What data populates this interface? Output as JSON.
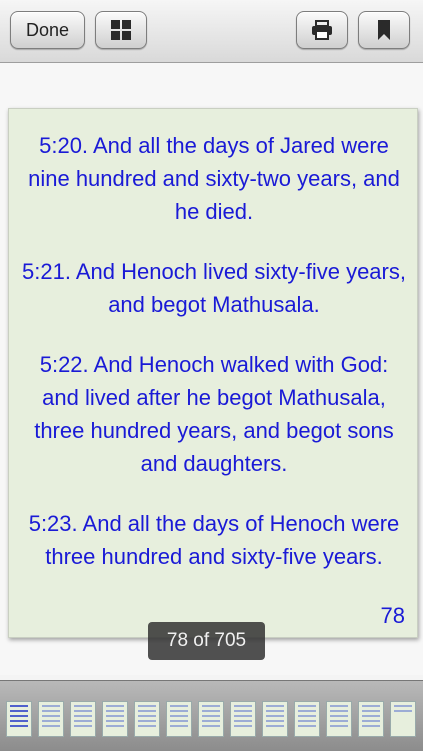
{
  "toolbar": {
    "done_label": "Done"
  },
  "page": {
    "verses": [
      "5:20. And all the days of Jared were nine hundred and sixty-two years, and he died.",
      "5:21. And Henoch lived sixty-five years, and begot Mathusala.",
      "5:22. And Henoch walked with God: and lived after he begot Mathusala, three hundred years, and begot sons and daughters.",
      "5:23. And all the days of Henoch were three hundred and sixty-five years."
    ],
    "page_number": "78"
  },
  "counter": {
    "text": "78 of 705"
  },
  "colors": {
    "page_bg": "#e7efdd",
    "verse_text": "#1a1ad6"
  }
}
